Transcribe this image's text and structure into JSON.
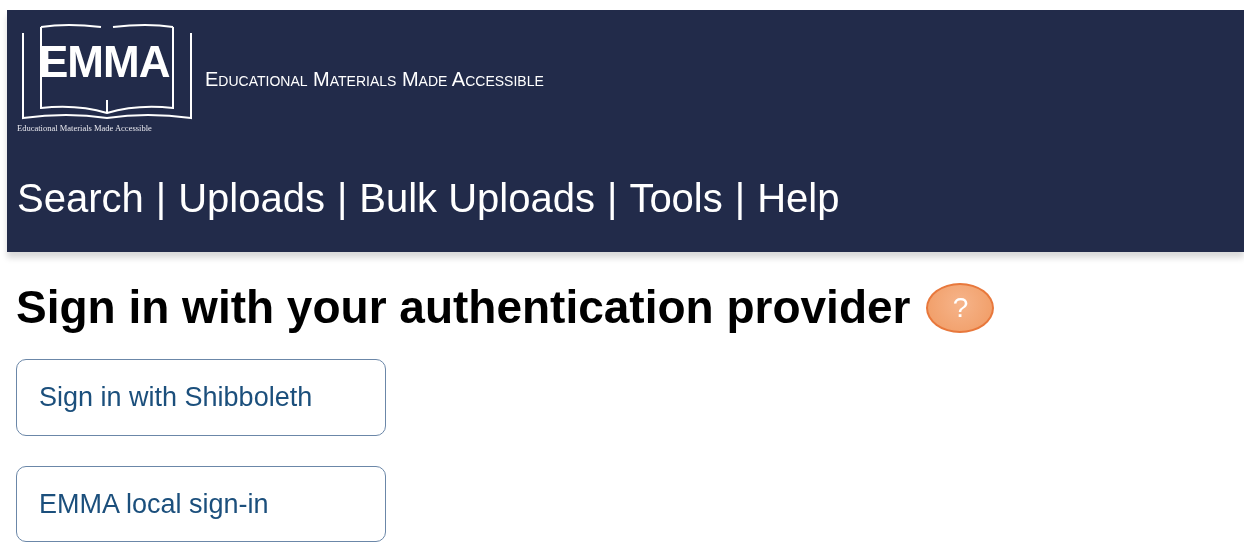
{
  "header": {
    "logo": {
      "wordmark": "EMMA",
      "caption": "Educational Materials Made Accessible"
    },
    "tagline": "Educational Materials Made Accessible"
  },
  "nav": {
    "separator": "|",
    "items": [
      {
        "label": "Search"
      },
      {
        "label": "Uploads"
      },
      {
        "label": "Bulk Uploads"
      },
      {
        "label": "Tools"
      },
      {
        "label": "Help"
      }
    ]
  },
  "heading": "Sign in with your authentication provider",
  "help_icon": "?",
  "buttons": [
    {
      "label": "Sign in with Shibboleth"
    },
    {
      "label": "EMMA local sign-in"
    }
  ]
}
